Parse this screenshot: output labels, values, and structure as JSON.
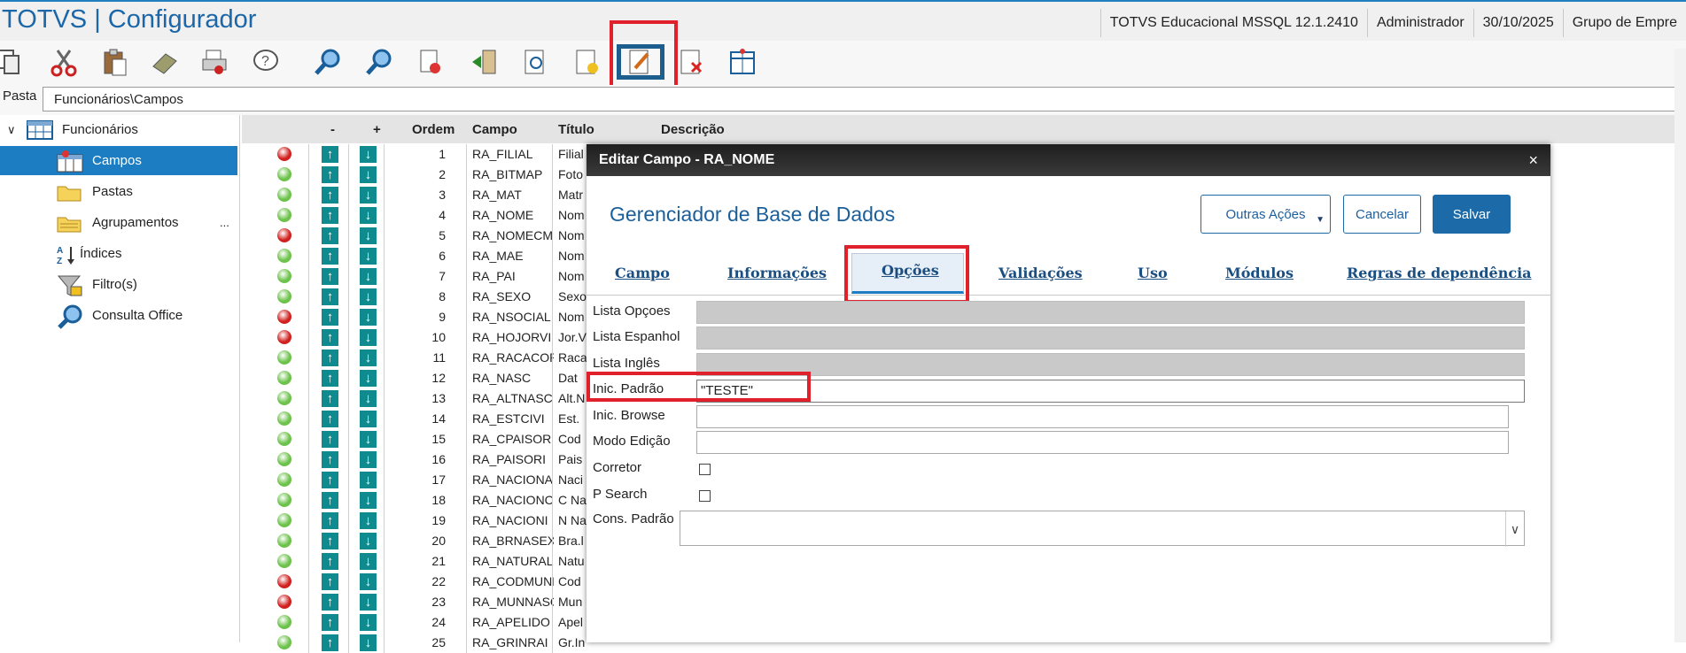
{
  "app": {
    "title": "TOTVS | Configurador"
  },
  "status_bar": [
    "TOTVS Educacional MSSQL 12.1.2410",
    "Administrador",
    "30/10/2025",
    "Grupo de Empre"
  ],
  "toolbar": {
    "buttons": [
      "copy-icon",
      "cut-icon",
      "paste-icon",
      "eraser-icon",
      "print-icon",
      "help-icon",
      "search-icon",
      "search-next-icon",
      "export-icon",
      "import-icon",
      "preview-icon",
      "add-field-icon",
      "edit-field-icon",
      "delete-field-icon",
      "table-icon"
    ]
  },
  "pasta": {
    "label": "Pasta",
    "value": "Funcionários\\Campos"
  },
  "tree": {
    "root": "Funcionários",
    "items": [
      "Campos",
      "Pastas",
      "Agrupamentos",
      "Índices",
      "Filtro(s)",
      "Consulta Office"
    ],
    "more": "..."
  },
  "grid": {
    "headers": {
      "minus": "-",
      "plus": "+",
      "ordem": "Ordem",
      "campo": "Campo",
      "titulo": "Título",
      "descricao": "Descrição"
    },
    "rows": [
      {
        "status": "red",
        "ordem": "1",
        "campo": "RA_FILIAL",
        "titulo": "Filial"
      },
      {
        "status": "green",
        "ordem": "2",
        "campo": "RA_BITMAP",
        "titulo": "Foto"
      },
      {
        "status": "green",
        "ordem": "3",
        "campo": "RA_MAT",
        "titulo": "Matr"
      },
      {
        "status": "green",
        "ordem": "4",
        "campo": "RA_NOME",
        "titulo": "Nom"
      },
      {
        "status": "red",
        "ordem": "5",
        "campo": "RA_NOMECMP",
        "titulo": "Nom"
      },
      {
        "status": "green",
        "ordem": "6",
        "campo": "RA_MAE",
        "titulo": "Nom"
      },
      {
        "status": "green",
        "ordem": "7",
        "campo": "RA_PAI",
        "titulo": "Nom"
      },
      {
        "status": "green",
        "ordem": "8",
        "campo": "RA_SEXO",
        "titulo": "Sexo"
      },
      {
        "status": "red",
        "ordem": "9",
        "campo": "RA_NSOCIAL",
        "titulo": "Nom"
      },
      {
        "status": "red",
        "ordem": "10",
        "campo": "RA_HOJORVI",
        "titulo": "Jor.V"
      },
      {
        "status": "green",
        "ordem": "11",
        "campo": "RA_RACACOR",
        "titulo": "Raca"
      },
      {
        "status": "green",
        "ordem": "12",
        "campo": "RA_NASC",
        "titulo": "Dat"
      },
      {
        "status": "green",
        "ordem": "13",
        "campo": "RA_ALTNASC",
        "titulo": "Alt.N"
      },
      {
        "status": "green",
        "ordem": "14",
        "campo": "RA_ESTCIVI",
        "titulo": "Est."
      },
      {
        "status": "green",
        "ordem": "15",
        "campo": "RA_CPAISOR",
        "titulo": "Cod"
      },
      {
        "status": "green",
        "ordem": "16",
        "campo": "RA_PAISORI",
        "titulo": "Pais"
      },
      {
        "status": "green",
        "ordem": "17",
        "campo": "RA_NACIONA",
        "titulo": "Naci"
      },
      {
        "status": "green",
        "ordem": "18",
        "campo": "RA_NACIONC",
        "titulo": "C Na"
      },
      {
        "status": "green",
        "ordem": "19",
        "campo": "RA_NACIONI",
        "titulo": "N Na"
      },
      {
        "status": "green",
        "ordem": "20",
        "campo": "RA_BRNASEX",
        "titulo": "Bra.l"
      },
      {
        "status": "green",
        "ordem": "21",
        "campo": "RA_NATURAL",
        "titulo": "Natu"
      },
      {
        "status": "red",
        "ordem": "22",
        "campo": "RA_CODMUNN",
        "titulo": "Cod"
      },
      {
        "status": "red",
        "ordem": "23",
        "campo": "RA_MUNNASC",
        "titulo": "Mun"
      },
      {
        "status": "green",
        "ordem": "24",
        "campo": "RA_APELIDO",
        "titulo": "Apel"
      },
      {
        "status": "green",
        "ordem": "25",
        "campo": "RA_GRINRAI",
        "titulo": "Gr.In"
      }
    ]
  },
  "dialog": {
    "title": "Editar Campo - RA_NOME",
    "close": "×",
    "heading": "Gerenciador de Base de Dados",
    "buttons": {
      "outras": "Outras Ações",
      "cancelar": "Cancelar",
      "salvar": "Salvar"
    },
    "tabs": [
      "Campo",
      "Informações",
      "Opções",
      "Validações",
      "Uso",
      "Módulos",
      "Regras de dependência"
    ],
    "active_tab": "Opções",
    "fields": {
      "lista_opcoes": {
        "label": "Lista Opçoes",
        "value": ""
      },
      "lista_espanhol": {
        "label": "Lista Espanhol",
        "value": ""
      },
      "lista_ingles": {
        "label": "Lista Inglês",
        "value": ""
      },
      "inic_padrao": {
        "label": "Inic. Padrão",
        "value": "\"TESTE\""
      },
      "inic_browse": {
        "label": "Inic. Browse",
        "value": ""
      },
      "modo_edicao": {
        "label": "Modo Edição",
        "value": ""
      },
      "corretor": {
        "label": "Corretor",
        "checked": false
      },
      "p_search": {
        "label": "P Search",
        "checked": false
      },
      "cons_padrao": {
        "label": "Cons. Padrão",
        "value": ""
      }
    }
  },
  "colors": {
    "accent": "#1c7dc2",
    "highlight": "#e0202a",
    "status_red": "#d0211f",
    "status_green": "#6cc24a",
    "arrow": "#0f8a8e"
  }
}
